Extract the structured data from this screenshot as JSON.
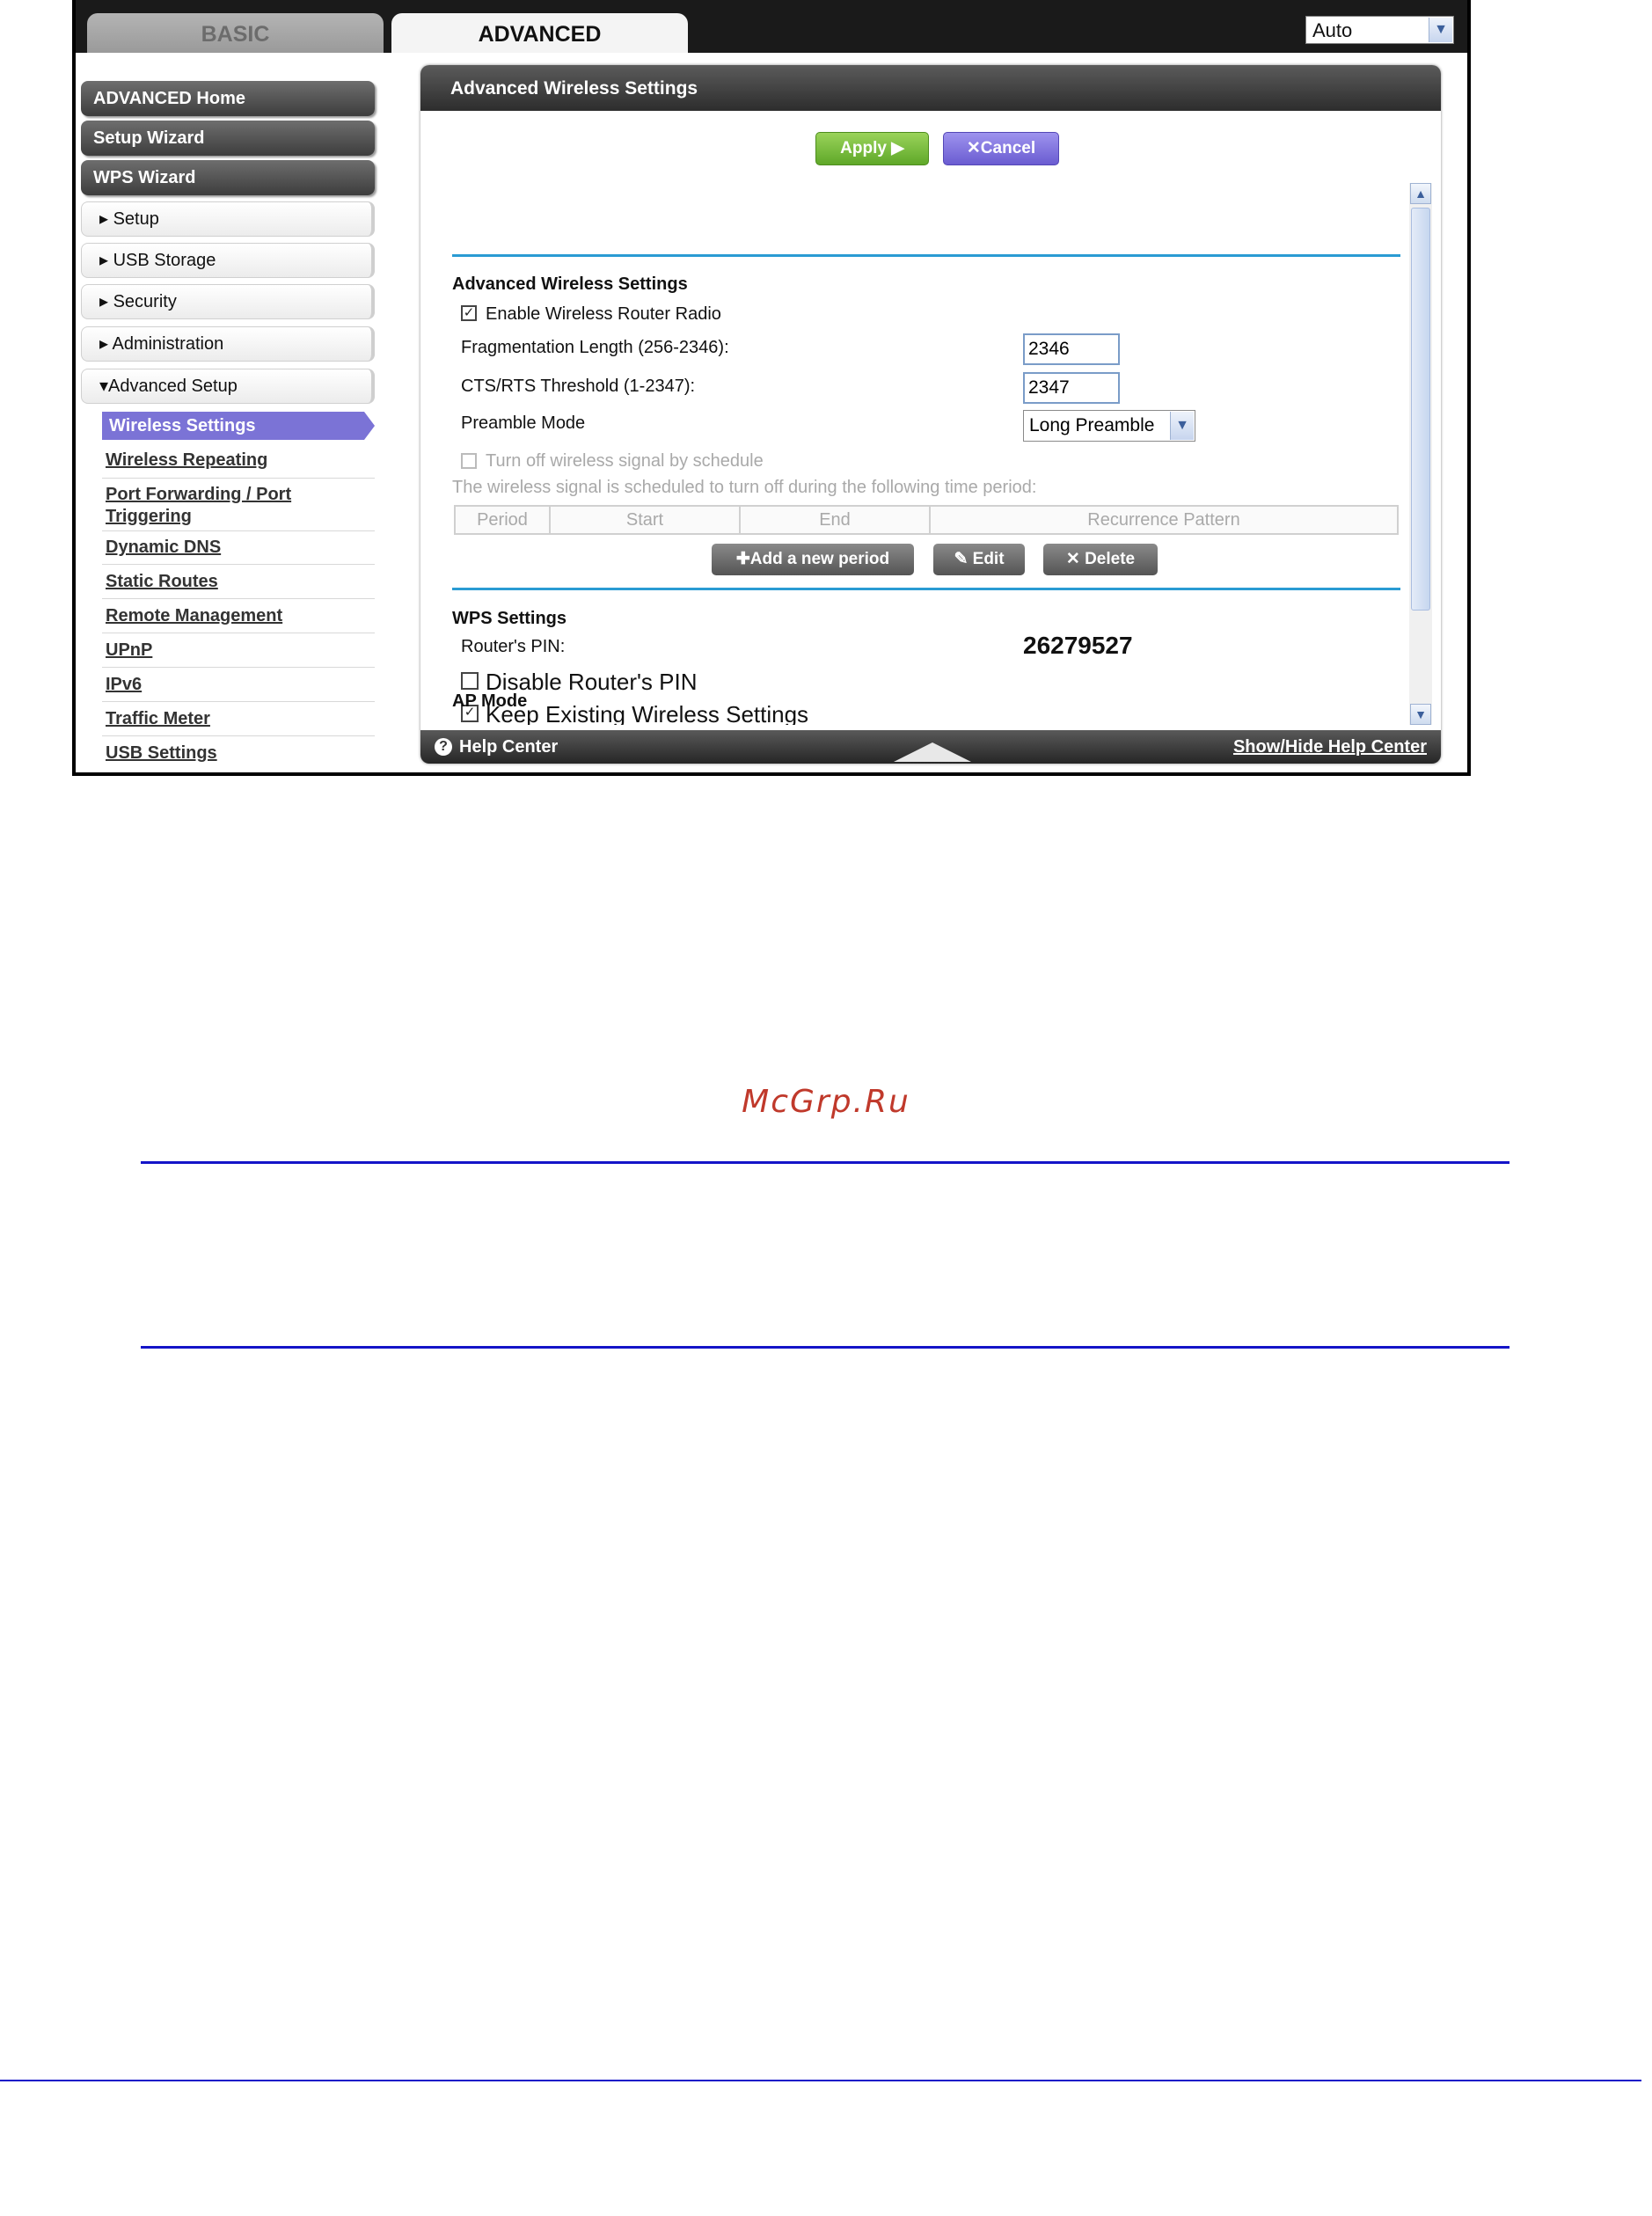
{
  "tabs": {
    "basic": "BASIC",
    "advanced": "ADVANCED"
  },
  "language_select": {
    "value": "Auto"
  },
  "sidebar": {
    "dark_items": [
      {
        "label": "ADVANCED Home"
      },
      {
        "label": "Setup Wizard"
      },
      {
        "label": "WPS Wizard"
      }
    ],
    "menu_items": [
      {
        "label": "▸ Setup"
      },
      {
        "label": "▸ USB Storage"
      },
      {
        "label": "▸ Security"
      },
      {
        "label": "▸ Administration"
      },
      {
        "label": "▾Advanced Setup"
      }
    ],
    "sub_items": [
      {
        "label": "Wireless Settings"
      },
      {
        "label": "Wireless Repeating"
      },
      {
        "label": "Port Forwarding / Port"
      },
      {
        "label": "Triggering"
      },
      {
        "label": "Dynamic DNS"
      },
      {
        "label": "Static Routes"
      },
      {
        "label": "Remote Management"
      },
      {
        "label": "UPnP"
      },
      {
        "label": "IPv6"
      },
      {
        "label": "Traffic Meter"
      },
      {
        "label": "USB Settings"
      }
    ]
  },
  "panel": {
    "title": "Advanced Wireless Settings",
    "apply_label": "Apply ▶",
    "cancel_label": "✕Cancel",
    "section_advanced": "Advanced Wireless Settings",
    "enable_radio_label": "Enable Wireless Router Radio",
    "frag_label": "Fragmentation Length (256-2346):",
    "frag_value": "2346",
    "cts_label": "CTS/RTS Threshold (1-2347):",
    "cts_value": "2347",
    "preamble_label": "Preamble Mode",
    "preamble_value": "Long Preamble",
    "schedule_label": "Turn off wireless signal by schedule",
    "schedule_note": "The wireless signal is scheduled to turn off during the following time period:",
    "table_headers": [
      "Period",
      "Start",
      "End",
      "Recurrence Pattern"
    ],
    "add_period": "✚Add a new period",
    "edit": "✎ Edit",
    "delete": "✕ Delete",
    "section_wps": "WPS Settings",
    "router_pin_label": "Router's PIN:",
    "router_pin_value": "26279527",
    "disable_pin_label": "Disable Router's PIN",
    "keep_settings_label": "Keep Existing Wireless Settings",
    "section_ap": "AP Mode",
    "help_center": "Help Center",
    "show_hide_help": "Show/Hide Help Center"
  },
  "watermark": "McGrp.Ru"
}
